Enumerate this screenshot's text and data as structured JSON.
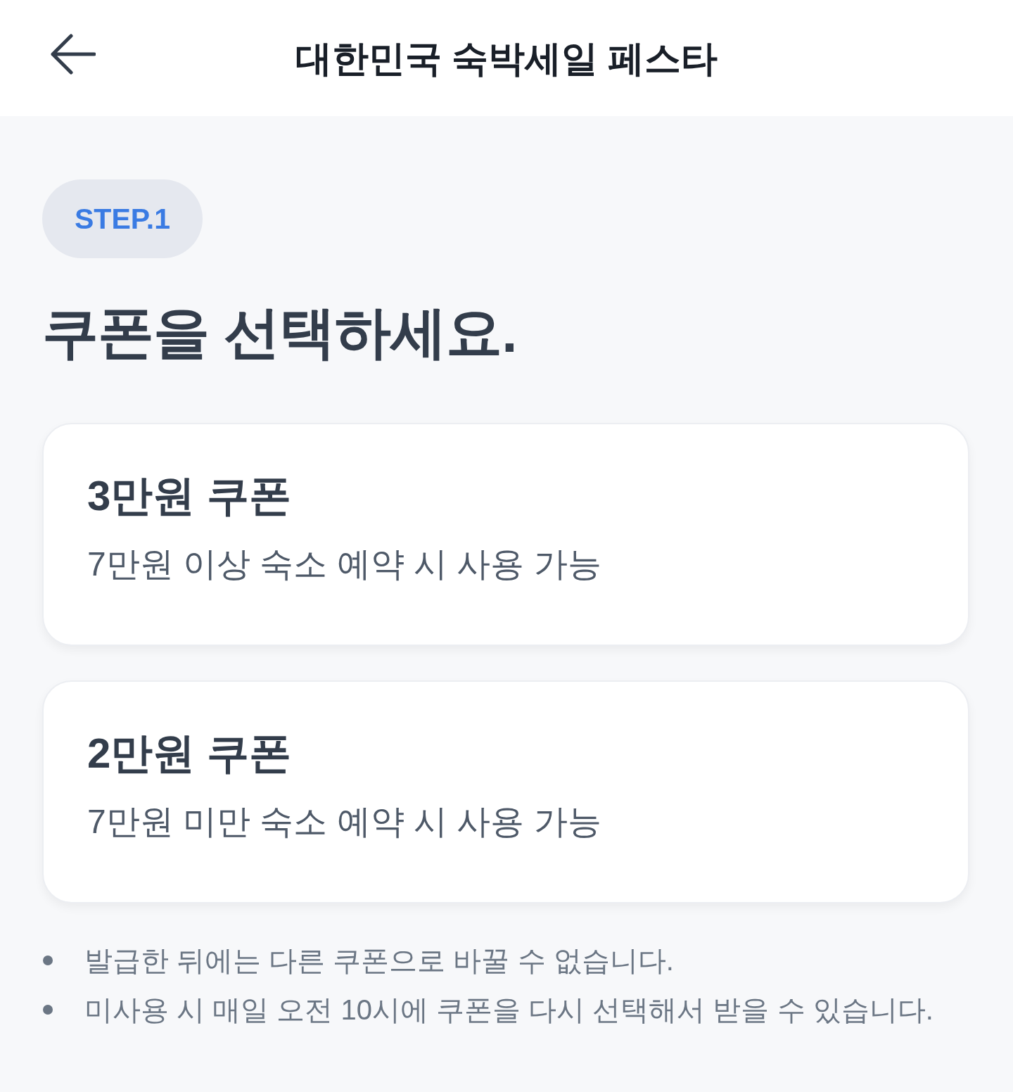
{
  "header": {
    "title": "대한민국 숙박세일 페스타"
  },
  "step_badge": "STEP.1",
  "heading": "쿠폰을 선택하세요.",
  "coupons": [
    {
      "title": "3만원 쿠폰",
      "condition": "7만원 이상 숙소 예약 시 사용 가능"
    },
    {
      "title": "2만원 쿠폰",
      "condition": "7만원 미만 숙소 예약 시 사용 가능"
    }
  ],
  "notes": [
    "발급한 뒤에는 다른 쿠폰으로 바꿀 수 없습니다.",
    "미사용 시 매일 오전 10시에 쿠폰을 다시 선택해서 받을 수 있습니다."
  ]
}
